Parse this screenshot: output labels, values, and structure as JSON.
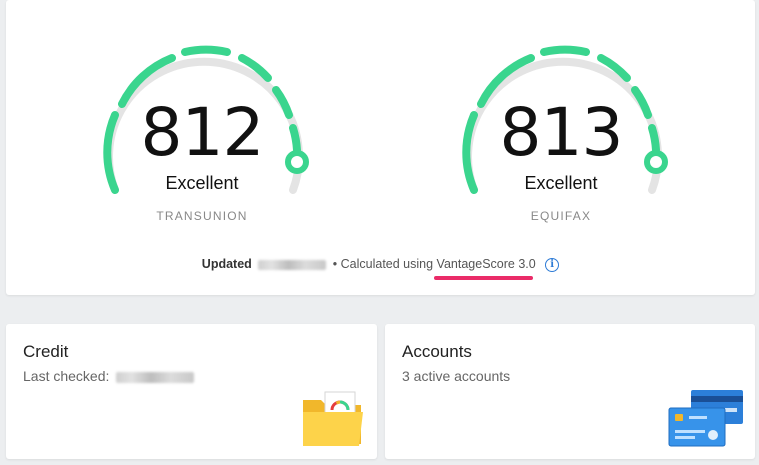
{
  "scores": [
    {
      "value": "812",
      "rating": "Excellent",
      "bureau": "TRANSUNION",
      "fraction": 0.94
    },
    {
      "value": "813",
      "rating": "Excellent",
      "bureau": "EQUIFAX",
      "fraction": 0.94
    }
  ],
  "updated": {
    "label": "Updated",
    "separator": "•",
    "calc_text": "Calculated using",
    "model": "VantageScore 3.0",
    "info_icon": "info-icon"
  },
  "tiles": {
    "credit": {
      "title": "Credit",
      "subtitle": "Last checked:",
      "icon": "credit-report-folder-icon"
    },
    "accounts": {
      "title": "Accounts",
      "subtitle": "3 active accounts",
      "icon": "credit-cards-icon"
    }
  },
  "colors": {
    "gauge": "#3ad58e",
    "gauge_track": "#e4e4e4",
    "underline": "#ea2b68",
    "info": "#2d7bd6"
  }
}
